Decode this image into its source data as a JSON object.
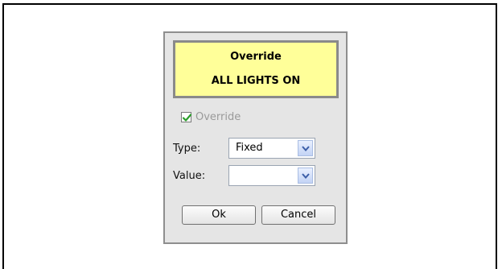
{
  "status": {
    "title": "Override",
    "message": "ALL LIGHTS ON"
  },
  "override_checkbox": {
    "label": "Override",
    "checked": true
  },
  "type_field": {
    "label": "Type:",
    "value": "Fixed"
  },
  "value_field": {
    "label": "Value:",
    "value": ""
  },
  "buttons": {
    "ok": "Ok",
    "cancel": "Cancel"
  },
  "icons": {
    "checkbox_check": "checkmark-icon",
    "dropdown_arrow": "chevron-down-icon"
  },
  "colors": {
    "status_background": "#ffff99",
    "dialog_background": "#e5e5e5",
    "check_color": "#2a9d2a",
    "disabled_text": "#9a9a9a"
  }
}
